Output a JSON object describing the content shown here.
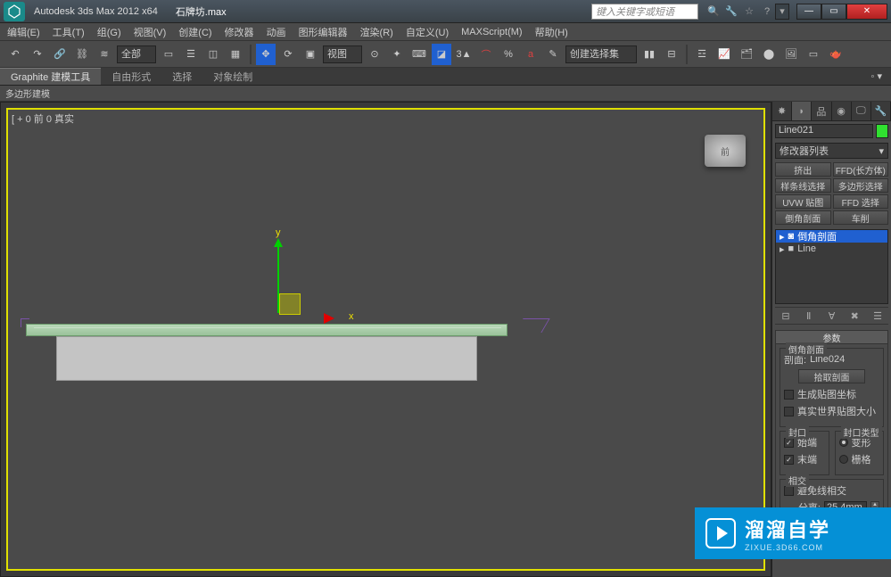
{
  "title": {
    "app": "Autodesk 3ds Max  2012 x64",
    "file": "石牌坊.max",
    "search_placeholder": "键入关键字或短语"
  },
  "menus": [
    "编辑(E)",
    "工具(T)",
    "组(G)",
    "视图(V)",
    "创建(C)",
    "修改器",
    "动画",
    "图形编辑器",
    "渲染(R)",
    "自定义(U)",
    "MAXScript(M)",
    "帮助(H)"
  ],
  "toolbar": {
    "sel_filter": "全部",
    "ref_sys": "视图",
    "cmd_set": "创建选择集"
  },
  "ribbon": {
    "tabs": [
      "Graphite 建模工具",
      "自由形式",
      "选择",
      "对象绘制"
    ],
    "group": "多边形建模"
  },
  "viewport": {
    "label": "[ + 0 前 0 真实",
    "cube_face": "前",
    "axis_y": "y",
    "axis_x": "x"
  },
  "cmd": {
    "name": "Line021",
    "modlist_label": "修改器列表",
    "buttons": [
      "挤出",
      "FFD(长方体)",
      "样条线选择",
      "多边形选择",
      "UVW 贴图",
      "FFD 选择",
      "倒角剖面",
      "车削"
    ],
    "stack": [
      {
        "label": "倒角剖面",
        "selected": true,
        "icon": "◙"
      },
      {
        "label": "Line",
        "selected": false,
        "icon": "■"
      }
    ],
    "rollout_title": "参数",
    "bevel_group": "倒角剖面",
    "profile_label": "剖面:",
    "profile_value": "Line024",
    "pick_btn": "拾取剖面",
    "gen_mapping": "生成贴图坐标",
    "real_world": "真实世界贴图大小",
    "cap_group": "封口",
    "cap_start": "始端",
    "cap_end": "末端",
    "cap_type_group": "封口类型",
    "cap_morph": "变形",
    "cap_grid": "栅格",
    "intersect_group": "相交",
    "avoid_intersect": "避免线相交",
    "separation_label": "分离:",
    "separation_value": "25.4mm"
  },
  "watermark": {
    "big": "溜溜自学",
    "small": "ZIXUE.3D66.COM"
  }
}
